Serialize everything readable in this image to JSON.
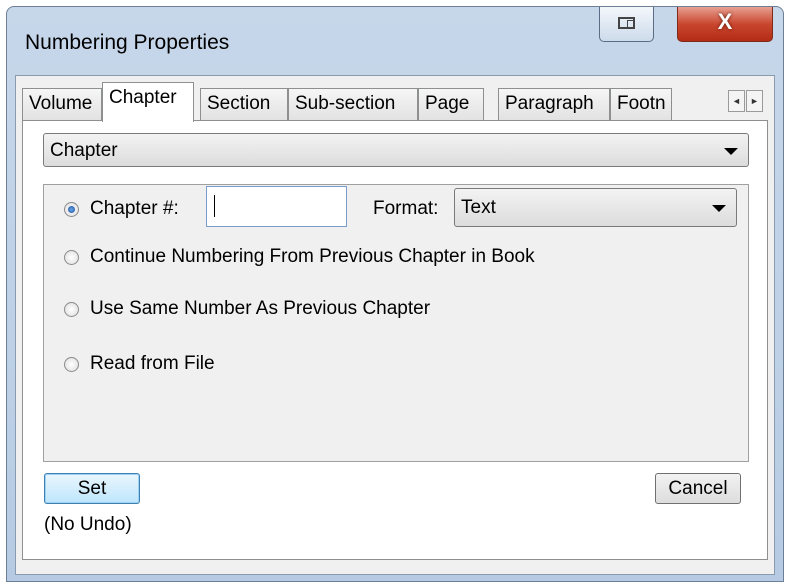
{
  "window": {
    "title": "Numbering Properties",
    "close_glyph": "X"
  },
  "tabs": [
    {
      "label": "Volume",
      "active": false
    },
    {
      "label": "Chapter",
      "active": true
    },
    {
      "label": "Section",
      "active": false
    },
    {
      "label": "Sub-section",
      "active": false
    },
    {
      "label": "Page",
      "active": false
    },
    {
      "label": "Paragraph",
      "active": false
    },
    {
      "label": "Footn",
      "active": false
    }
  ],
  "tab_scroll": {
    "left": "◄",
    "right": "►"
  },
  "level_select": {
    "value": "Chapter"
  },
  "options": {
    "chapter_number_label": "Chapter #:",
    "chapter_number_value": "",
    "format_label": "Format:",
    "format_value": "Text",
    "continue_label": "Continue Numbering From Previous Chapter in Book",
    "same_label": "Use Same Number As Previous Chapter",
    "read_label": "Read from File",
    "selected": "chapter_number"
  },
  "buttons": {
    "set": "Set",
    "cancel": "Cancel"
  },
  "note": "(No Undo)"
}
